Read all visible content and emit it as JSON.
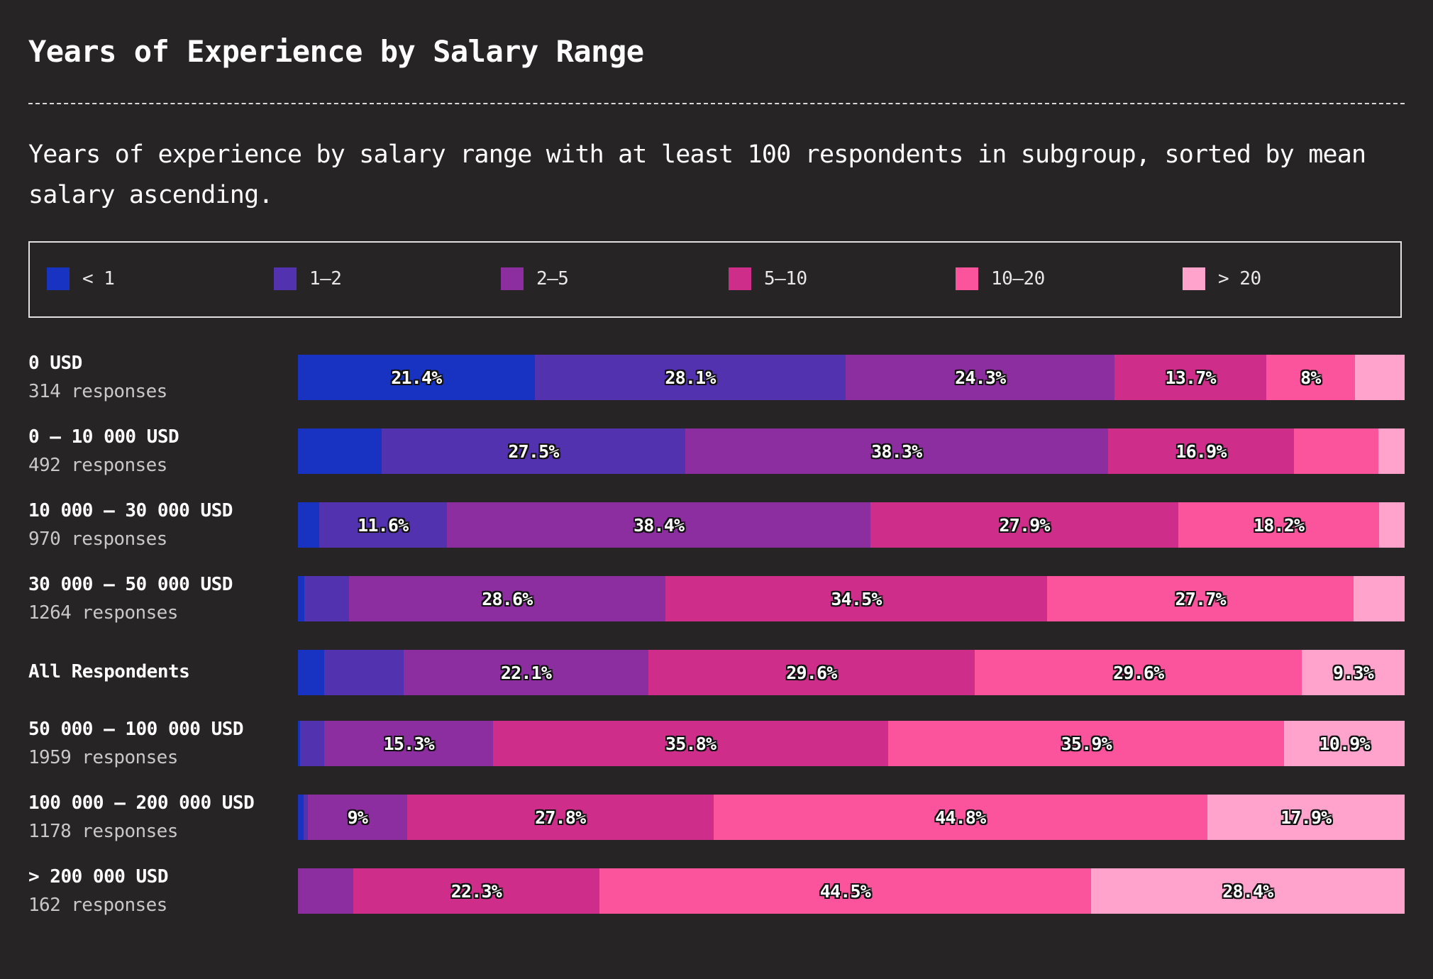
{
  "chart_data": {
    "type": "bar",
    "orientation": "horizontal",
    "stacked": true,
    "title": "Years of Experience by Salary Range",
    "subtitle": "Years of experience by salary range with at least 100 respondents in subgroup, sorted by mean salary ascending.",
    "xlim": [
      0,
      100
    ],
    "legend_position": "top",
    "series": [
      {
        "name": "< 1",
        "color": "#1833c2"
      },
      {
        "name": "1–2",
        "color": "#5232ae"
      },
      {
        "name": "2–5",
        "color": "#8c2e9f"
      },
      {
        "name": "5–10",
        "color": "#ce2d8a"
      },
      {
        "name": "10–20",
        "color": "#fb549c"
      },
      {
        "name": "> 20",
        "color": "#ffa2cc"
      }
    ],
    "rows": [
      {
        "label": "0 USD",
        "count": "314 responses",
        "values": [
          21.4,
          28.1,
          24.3,
          13.7,
          8.0,
          4.5
        ],
        "labels": [
          "21.4%",
          "28.1%",
          "24.3%",
          "13.7%",
          "8%",
          ""
        ]
      },
      {
        "label": "0 – 10 000 USD",
        "count": "492 responses",
        "values": [
          7.6,
          27.5,
          38.3,
          16.9,
          7.6,
          2.4
        ],
        "labels": [
          "",
          "27.5%",
          "38.3%",
          "16.9%",
          "",
          ""
        ]
      },
      {
        "label": "10 000 – 30 000 USD",
        "count": "970 responses",
        "values": [
          1.9,
          11.6,
          38.4,
          27.9,
          18.2,
          2.3
        ],
        "labels": [
          "",
          "11.6%",
          "38.4%",
          "27.9%",
          "18.2%",
          ""
        ]
      },
      {
        "label": "30 000 – 50 000 USD",
        "count": "1264 responses",
        "values": [
          0.6,
          4.0,
          28.6,
          34.5,
          27.7,
          4.6
        ],
        "labels": [
          "",
          "",
          "28.6%",
          "34.5%",
          "27.7%",
          ""
        ]
      },
      {
        "label": "All Respondents",
        "count": "",
        "values": [
          2.4,
          7.2,
          22.1,
          29.6,
          29.6,
          9.3
        ],
        "labels": [
          "",
          "",
          "22.1%",
          "29.6%",
          "29.6%",
          "9.3%"
        ]
      },
      {
        "label": "50 000 – 100 000 USD",
        "count": "1959 responses",
        "values": [
          0.2,
          2.2,
          15.3,
          35.8,
          35.9,
          10.9
        ],
        "labels": [
          "",
          "",
          "15.3%",
          "35.8%",
          "35.9%",
          "10.9%"
        ]
      },
      {
        "label": "100 000 – 200 000 USD",
        "count": "1178 responses",
        "values": [
          0.5,
          0.4,
          9.0,
          27.8,
          44.8,
          17.9
        ],
        "labels": [
          "",
          "",
          "9%",
          "27.8%",
          "44.8%",
          "17.9%"
        ]
      },
      {
        "label": "> 200 000 USD",
        "count": "162 responses",
        "values": [
          0,
          5.0,
          22.3,
          44.5,
          28.4,
          0
        ],
        "labels": [
          "",
          "",
          "22.3%",
          "44.5%",
          "28.4%",
          ""
        ],
        "series_index": [
          0,
          2,
          3,
          4,
          5,
          1
        ]
      }
    ]
  }
}
